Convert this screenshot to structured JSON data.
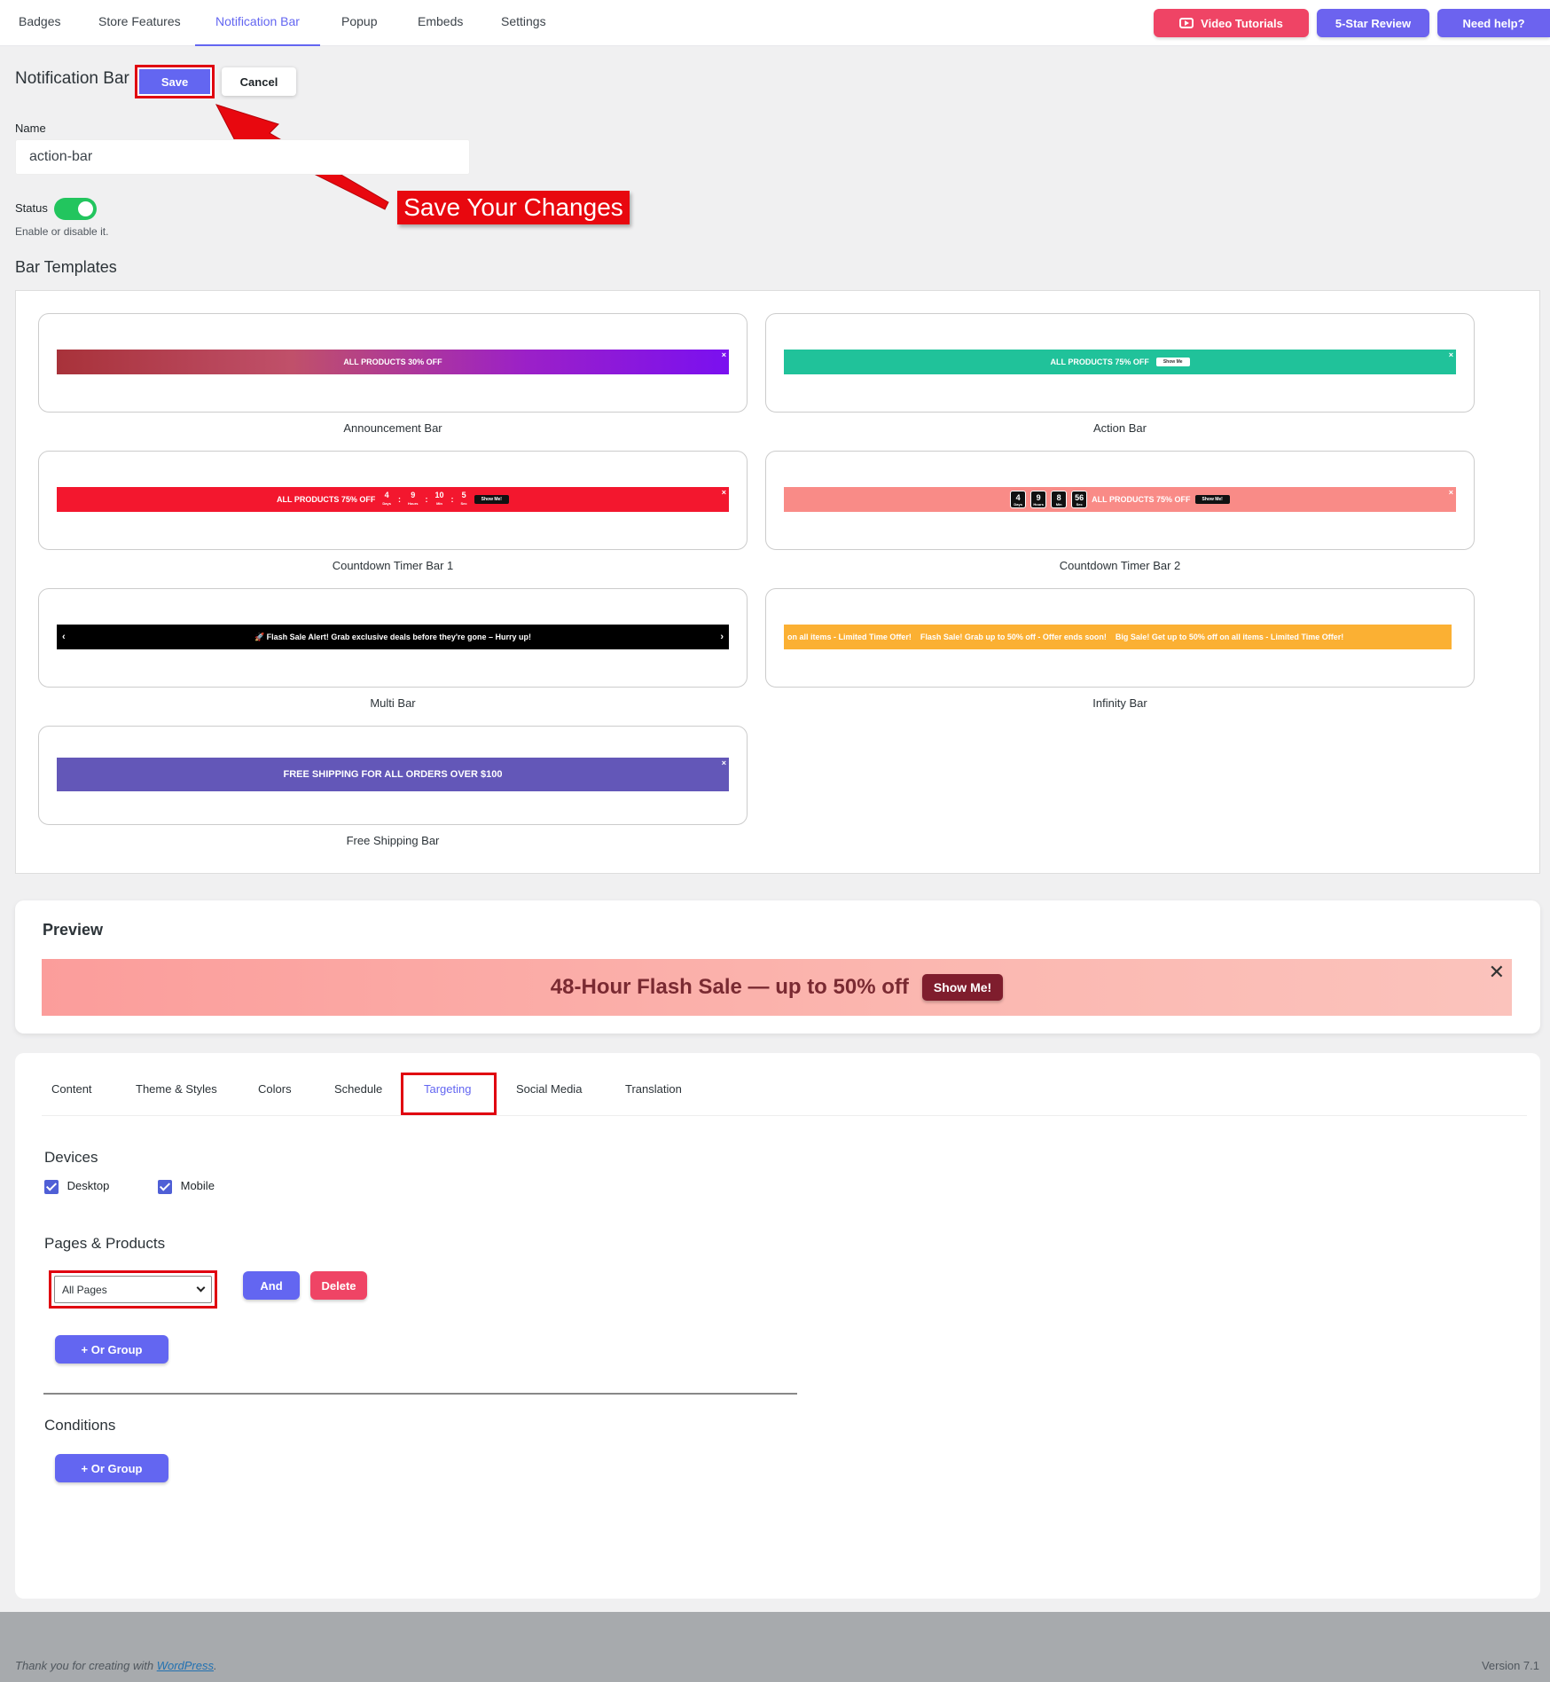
{
  "nav": {
    "tabs": [
      "Badges",
      "Store Features",
      "Notification Bar",
      "Popup",
      "Embeds",
      "Settings"
    ],
    "video_tutorials": "Video Tutorials",
    "review": "5-Star Review",
    "help": "Need help?"
  },
  "page": {
    "title": "Notification Bar",
    "save": "Save",
    "cancel": "Cancel",
    "name_label": "Name",
    "name_value": "action-bar",
    "status_label": "Status",
    "status_enabled": true,
    "status_help": "Enable or disable it.",
    "callout": "Save Your Changes"
  },
  "templates": {
    "title": "Bar Templates",
    "announcement": {
      "label": "Announcement Bar",
      "text": "ALL PRODUCTS 30% OFF"
    },
    "action": {
      "label": "Action Bar",
      "text": "ALL PRODUCTS 75% OFF",
      "button": "Show Me"
    },
    "countdown1": {
      "label": "Countdown Timer Bar 1",
      "text": "ALL PRODUCTS 75% OFF",
      "button": "Show Me!",
      "days": "4",
      "hours": "9",
      "mins": "10",
      "secs": "5",
      "u_days": "Days",
      "u_hours": "Hours",
      "u_mins": "Min",
      "u_secs": "Sec"
    },
    "countdown2": {
      "label": "Countdown Timer Bar 2",
      "text": "ALL PRODUCTS 75% OFF",
      "button": "Show Me!",
      "days": "4",
      "hours": "9",
      "mins": "8",
      "secs": "56",
      "u_days": "Days",
      "u_hours": "Hours",
      "u_mins": "Min",
      "u_secs": "Sec"
    },
    "multi": {
      "label": "Multi Bar",
      "text": "🚀 Flash Sale Alert! Grab exclusive deals before they're gone – Hurry up!"
    },
    "infinity": {
      "label": "Infinity Bar",
      "text": "on all items - Limited Time Offer!    Flash Sale! Grab up to 50% off - Offer ends soon!    Big Sale! Get up to 50% off on all items - Limited Time Offer!"
    },
    "shipping": {
      "label": "Free Shipping Bar",
      "text": "FREE SHIPPING FOR ALL ORDERS OVER $100"
    },
    "close": "×"
  },
  "preview": {
    "title": "Preview",
    "text": "48-Hour Flash Sale — up to 50% off",
    "button": "Show Me!",
    "close": "✕"
  },
  "settings": {
    "tabs": [
      "Content",
      "Theme & Styles",
      "Colors",
      "Schedule",
      "Targeting",
      "Social Media",
      "Translation"
    ],
    "active_tab": "Targeting",
    "devices_title": "Devices",
    "desktop": "Desktop",
    "mobile": "Mobile",
    "pages_title": "Pages & Products",
    "page_select": "All Pages",
    "and": "And",
    "delete": "Delete",
    "or_group": "+ Or Group",
    "conditions_title": "Conditions",
    "or_group2": "+ Or Group"
  },
  "footer": {
    "thanks": "Thank you for creating with ",
    "wp": "WordPress",
    "period": ".",
    "version": "Version 7.1"
  },
  "colors": {
    "accent": "#6366f1",
    "danger": "#ef4465",
    "toggle_on": "#22c55e",
    "highlight_red": "#e00010"
  }
}
